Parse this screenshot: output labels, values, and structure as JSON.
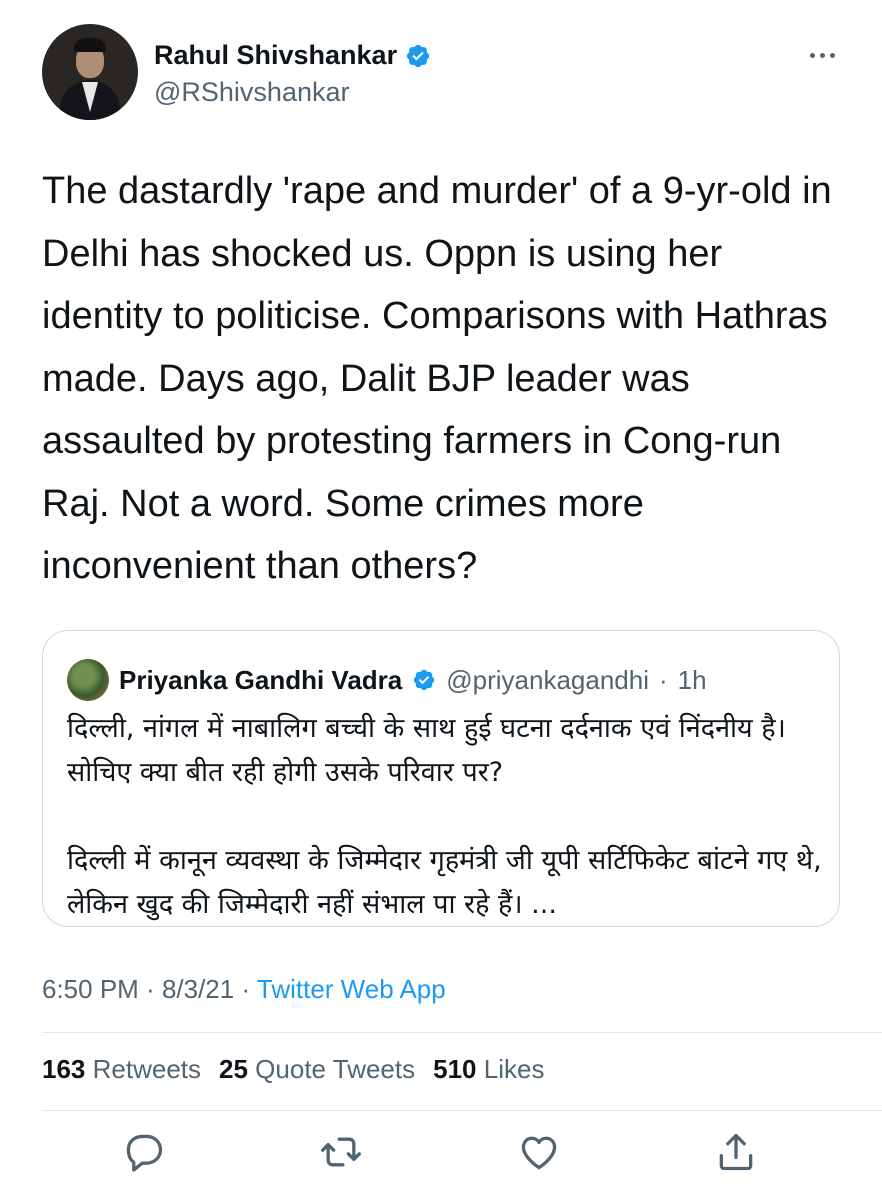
{
  "author": {
    "name": "Rahul Shivshankar",
    "handle": "@RShivshankar",
    "verified": true
  },
  "tweet": {
    "text": "The dastardly 'rape and murder' of a 9-yr-old in Delhi has shocked us. Oppn is using her identity to politicise. Comparisons with Hathras made. Days ago, Dalit BJP leader was assaulted by protesting farmers in Cong-run Raj. Not a word. Some crimes more inconvenient than others?"
  },
  "quoted_tweet": {
    "name": "Priyanka Gandhi Vadra",
    "handle": "@priyankagandhi",
    "separator": "·",
    "time": "1h",
    "verified": true,
    "paragraph1": "दिल्ली, नांगल में नाबालिग बच्ची के साथ हुई घटना दर्दनाक एवं निंदनीय है। सोचिए क्या बीत रही होगी उसके परिवार पर?",
    "paragraph2": "दिल्ली में कानून व्यवस्था के जिम्मेदार गृहमंत्री जी यूपी सर्टिफिकेट बांटने गए थे, लेकिन खुद की जिम्मेदारी नहीं संभाल पा रहे हैं। ..."
  },
  "meta": {
    "time": "6:50 PM",
    "separator1": " · ",
    "date": "8/3/21",
    "separator2": " · ",
    "source": "Twitter Web App"
  },
  "stats": {
    "retweets_count": "163",
    "retweets_label": "Retweets",
    "quotes_count": "25",
    "quotes_label": "Quote Tweets",
    "likes_count": "510",
    "likes_label": "Likes"
  },
  "icons": {
    "reply": "reply-icon",
    "retweet": "retweet-icon",
    "like": "heart-icon",
    "share": "share-icon",
    "more": "more-dots-icon",
    "verified": "verified-badge-icon"
  },
  "colors": {
    "accent": "#1d9bf0",
    "text": "#0f1419",
    "secondary": "#536471",
    "border": "#cfd9de"
  }
}
